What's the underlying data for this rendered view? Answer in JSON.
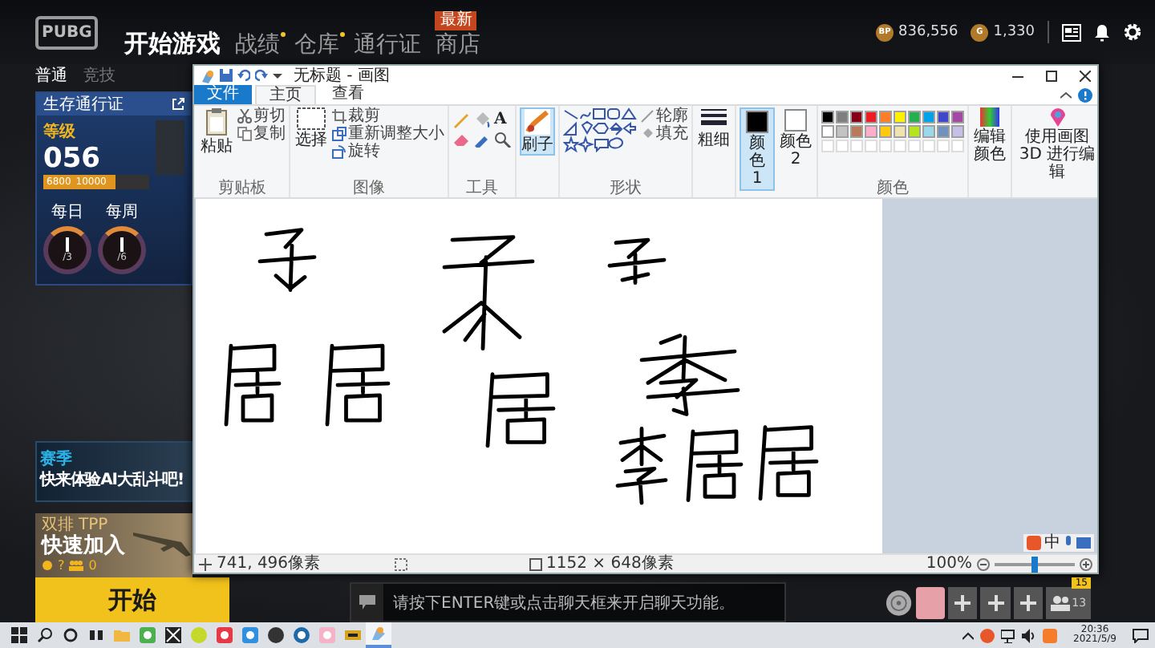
{
  "game": {
    "logo": "PUBG",
    "nav": [
      {
        "label": "开始游戏",
        "selected": true,
        "dot": false
      },
      {
        "label": "战绩",
        "selected": false,
        "dot": true
      },
      {
        "label": "仓库",
        "selected": false,
        "dot": true
      },
      {
        "label": "通行证",
        "selected": false,
        "dot": false
      },
      {
        "label": "商店",
        "selected": false,
        "dot": false,
        "badge": "最新"
      }
    ],
    "currencies": [
      {
        "symbol": "BP",
        "amount": "836,556"
      },
      {
        "symbol": "G",
        "amount": "1,330"
      }
    ],
    "subnav": [
      {
        "label": "普通",
        "selected": true
      },
      {
        "label": "竞技",
        "selected": false
      }
    ],
    "pass_card": {
      "title": "生存通行证",
      "level_label": "等级",
      "level_value": "056",
      "progress": {
        "level": 0.68
      },
      "progress_text": "6800",
      "progress_max": "10000",
      "missions": [
        {
          "label": "每日",
          "count": "/3"
        },
        {
          "label": "每周",
          "count": "/6"
        }
      ]
    },
    "banner": {
      "tag": "赛季",
      "text": "快来体验AI大乱斗吧!"
    },
    "quick_join": {
      "mode": "双排",
      "view": "TPP",
      "title": "快速加入",
      "time": "?",
      "players": "0"
    },
    "start_button": "开始",
    "chat": {
      "placeholder": "请按下ENTER键或点击聊天框来开启聊天功能。"
    },
    "party": {
      "badge": "15",
      "count": "13"
    }
  },
  "paint": {
    "title": "无标题 - 画图",
    "tabs": [
      {
        "label": "文件",
        "kind": "file",
        "selected": false
      },
      {
        "label": "主页",
        "kind": "tab",
        "selected": true
      },
      {
        "label": "查看",
        "kind": "tab",
        "selected": false
      }
    ],
    "clipboard": {
      "paste": "粘贴",
      "cut": "剪切",
      "copy": "复制",
      "label": "剪贴板"
    },
    "image": {
      "select": "选择",
      "crop": "裁剪",
      "resize": "重新调整大小",
      "rotate": "旋转",
      "label": "图像"
    },
    "tools": {
      "text_tool": "A",
      "label": "工具"
    },
    "brushes": {
      "label": "刷子"
    },
    "shapes": {
      "outline": "轮廓",
      "fill": "填充",
      "label": "形状"
    },
    "size": "粗细",
    "color1": {
      "label": "颜色 1",
      "color": "#000000",
      "selected": true
    },
    "color2": {
      "label": "颜色 2",
      "color": "#ffffff",
      "selected": false
    },
    "palette": {
      "label": "颜色",
      "colors": [
        {
          "color": "#000000"
        },
        {
          "color": "#7f7f7f"
        },
        {
          "color": "#880015"
        },
        {
          "color": "#ed1c24"
        },
        {
          "color": "#ff7f27"
        },
        {
          "color": "#fff200"
        },
        {
          "color": "#22b14c"
        },
        {
          "color": "#00a2e8"
        },
        {
          "color": "#3f48cc"
        },
        {
          "color": "#a349a4"
        },
        {
          "color": "#ffffff"
        },
        {
          "color": "#c3c3c3"
        },
        {
          "color": "#b97a57"
        },
        {
          "color": "#ffaec9"
        },
        {
          "color": "#ffc90e"
        },
        {
          "color": "#efe4b0"
        },
        {
          "color": "#b5e61d"
        },
        {
          "color": "#99d9ea"
        },
        {
          "color": "#7092be"
        },
        {
          "color": "#c8bfe7"
        }
      ]
    },
    "edit_colors": "编辑颜色",
    "paint3d": "使用画图 3D 进行编辑",
    "ime": "中",
    "status": {
      "cursor": "741, 496像素",
      "canvas_size": "1152 × 648像素",
      "zoom": "100%",
      "zoom_slider": {
        "level": 0.5
      }
    }
  },
  "taskbar": {
    "time": "20:36",
    "date": "2021/5/9"
  }
}
